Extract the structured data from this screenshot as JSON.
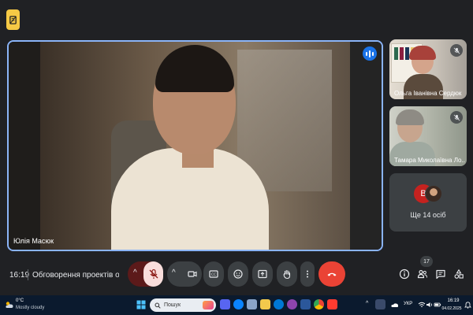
{
  "meeting": {
    "time": "16:19",
    "title": "Обговорення проектів осві..."
  },
  "main_tile": {
    "participant_name": "Юлія Масюк",
    "speaking": true
  },
  "side_tiles": [
    {
      "participant_name": "Ольга Іванівна Сердюк",
      "muted": true
    },
    {
      "participant_name": "Тамара Миколаївна Ло...",
      "muted": true
    }
  ],
  "more_tile": {
    "avatar_initial": "В",
    "label": "Ще 14 осіб"
  },
  "controls": {
    "mic": "mic-off",
    "camera": "camera",
    "captions": "captions",
    "reactions": "emoji",
    "present": "present",
    "raise_hand": "hand",
    "more": "more-options",
    "end_call": "end-call"
  },
  "right_controls": {
    "people_count": "17"
  },
  "taskbar": {
    "weather_temp": "0°C",
    "weather_desc": "Mostly cloudy",
    "search_placeholder": "Пошук",
    "language": "УКР",
    "clock_time": "16:19",
    "clock_date": "04.02.2025"
  },
  "colors": {
    "accent": "#8ab4f8",
    "end_call": "#ea4335",
    "mic_off": "#f9dedc",
    "badge": "#f6c945",
    "avatar": "#c5221f"
  }
}
